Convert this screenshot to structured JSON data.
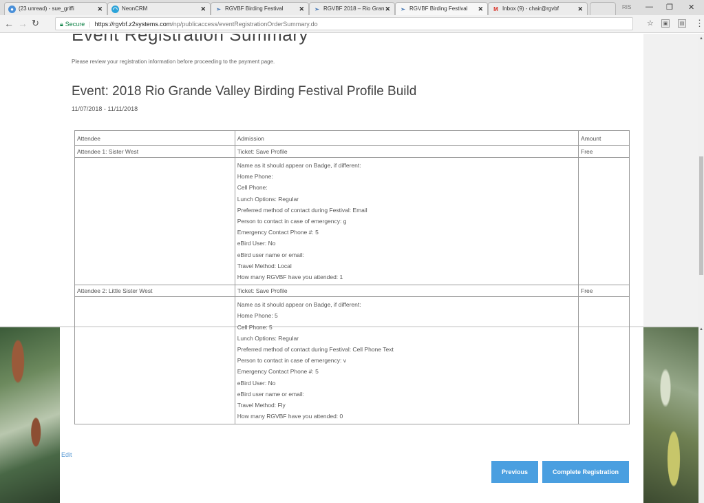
{
  "browser": {
    "tabs": [
      {
        "title": "(23 unread) - sue_griffi",
        "icon": "yahoo-mail-icon",
        "active": false
      },
      {
        "title": "NeonCRM",
        "icon": "neoncrm-icon",
        "active": false
      },
      {
        "title": "RGVBF Birding Festival",
        "icon": "rgvbf-bird-icon",
        "active": false
      },
      {
        "title": "RGVBF 2018 – Rio Gran",
        "icon": "rgvbf-bird-icon",
        "active": false
      },
      {
        "title": "RGVBF Birding Festival",
        "icon": "rgvbf-bird-icon",
        "active": true
      },
      {
        "title": "Inbox (9) - chair@rgvbf",
        "icon": "gmail-icon",
        "active": false
      }
    ],
    "profile_label": "RIS",
    "secure_label": "Secure",
    "url_host": "https://rgvbf.z2systems.com",
    "url_path": "/np/publicaccess/eventRegistrationOrderSummary.do"
  },
  "page": {
    "heading": "Event Registration Summary",
    "review_text": "Please review your registration information before proceeding to the payment page.",
    "event_title": "Event: 2018 Rio Grande Valley Birding Festival Profile Build",
    "dates": "11/07/2018 - 11/11/2018",
    "table": {
      "headers": {
        "attendee": "Attendee",
        "admission": "Admission",
        "amount": "Amount"
      },
      "attendees": [
        {
          "name": "Attendee 1: Sister West",
          "ticket": "Ticket: Save Profile",
          "amount": "Free",
          "details": [
            "Name as it should appear on Badge, if different:",
            "Home Phone:",
            "Cell Phone:",
            "Lunch Options: Regular",
            "Preferred method of contact during Festival: Email",
            "Person to contact in case of emergency: g",
            "Emergency Contact Phone #: 5",
            "eBird User: No",
            "eBird user name or email:",
            "Travel Method: Local",
            "How many RGVBF have you attended: 1"
          ]
        },
        {
          "name": "Attendee 2: Little Sister West",
          "ticket": "Ticket: Save Profile",
          "amount": "Free",
          "details": [
            "Name as it should appear on Badge, if different:",
            "Home Phone: 5",
            "Cell Phone: 5",
            "Lunch Options: Regular",
            "Preferred method of contact during Festival: Cell Phone Text",
            "Person to contact in case of emergency: v",
            "Emergency Contact Phone #: 5",
            "eBird User: No",
            "eBird user name or email:",
            "Travel Method: Fly",
            "How many RGVBF have you attended: 0"
          ]
        }
      ]
    },
    "edit_label": "Edit",
    "previous_label": "Previous",
    "complete_label": "Complete Registration",
    "button_color": "#4a9fe0"
  }
}
